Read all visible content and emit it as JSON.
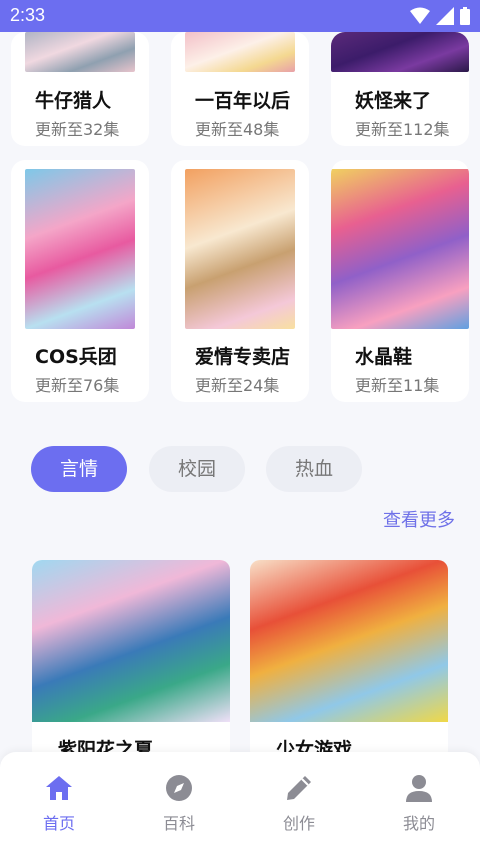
{
  "status_bar": {
    "time": "2:33"
  },
  "colors": {
    "accent": "#6c6ef0",
    "nav_inactive": "#8c8c94"
  },
  "rows": {
    "row1": [
      {
        "title": "牛仔猎人",
        "subtitle": "更新至32集"
      },
      {
        "title": "一百年以后",
        "subtitle": "更新至48集"
      },
      {
        "title": "妖怪来了",
        "subtitle": "更新至112集"
      }
    ],
    "row2": [
      {
        "title": "COS兵团",
        "subtitle": "更新至76集"
      },
      {
        "title": "爱情专卖店",
        "subtitle": "更新至24集"
      },
      {
        "title": "水晶鞋",
        "subtitle": "更新至11集"
      }
    ]
  },
  "tabs": [
    {
      "label": "言情",
      "active": true
    },
    {
      "label": "校园",
      "active": false
    },
    {
      "label": "热血",
      "active": false
    }
  ],
  "more_link": "查看更多",
  "featured": [
    {
      "title": "紫阳花之夏"
    },
    {
      "title": "少女游戏"
    }
  ],
  "nav": [
    {
      "label": "首页",
      "icon": "home-icon",
      "active": true
    },
    {
      "label": "百科",
      "icon": "compass-icon",
      "active": false
    },
    {
      "label": "创作",
      "icon": "pencil-icon",
      "active": false
    },
    {
      "label": "我的",
      "icon": "user-icon",
      "active": false
    }
  ]
}
